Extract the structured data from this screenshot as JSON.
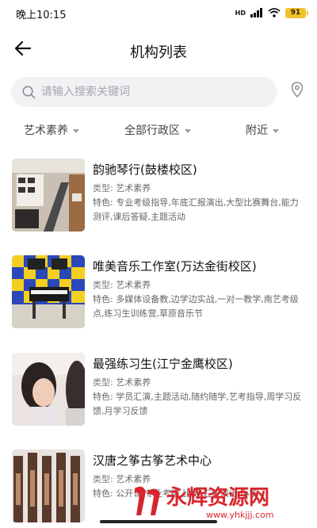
{
  "status_bar": {
    "time": "晚上10:15",
    "network": "HD",
    "battery": "91"
  },
  "nav": {
    "title": "机构列表"
  },
  "search": {
    "placeholder": "请输入搜索关键词"
  },
  "filters": [
    {
      "label": "艺术素养"
    },
    {
      "label": "全部行政区"
    },
    {
      "label": "附近"
    }
  ],
  "type_label": "类型:",
  "features_label": "特色:",
  "institutions": [
    {
      "name": "韵驰琴行(鼓楼校区)",
      "type": "艺术素养",
      "features": "专业考级指导,年底汇报演出,大型比赛舞台,能力测评,课后答疑,主题活动"
    },
    {
      "name": "唯美音乐工作室(万达金街校区)",
      "type": "艺术素养",
      "features": "多媒体设备教,边学边实战,一对一教学,南艺考级点,练习生训练营,草原音乐节"
    },
    {
      "name": "最强练习生(江宁金鹰校区)",
      "type": "艺术素养",
      "features": "学员汇演,主题活动,随约随学,艺考指导,周学习反馈,月学习反馈"
    },
    {
      "name": "汉唐之筝古筝艺术中心",
      "type": "艺术素养",
      "features": "公开课,专业考级,比赛,汇报演出,小筝"
    }
  ],
  "watermark": {
    "text": "永辉资源网",
    "url": "www.yhkjjj.com"
  },
  "colors": {
    "accent_red": "#d8262e",
    "search_bg": "#f1f2f4",
    "battery": "#f2c22a"
  }
}
